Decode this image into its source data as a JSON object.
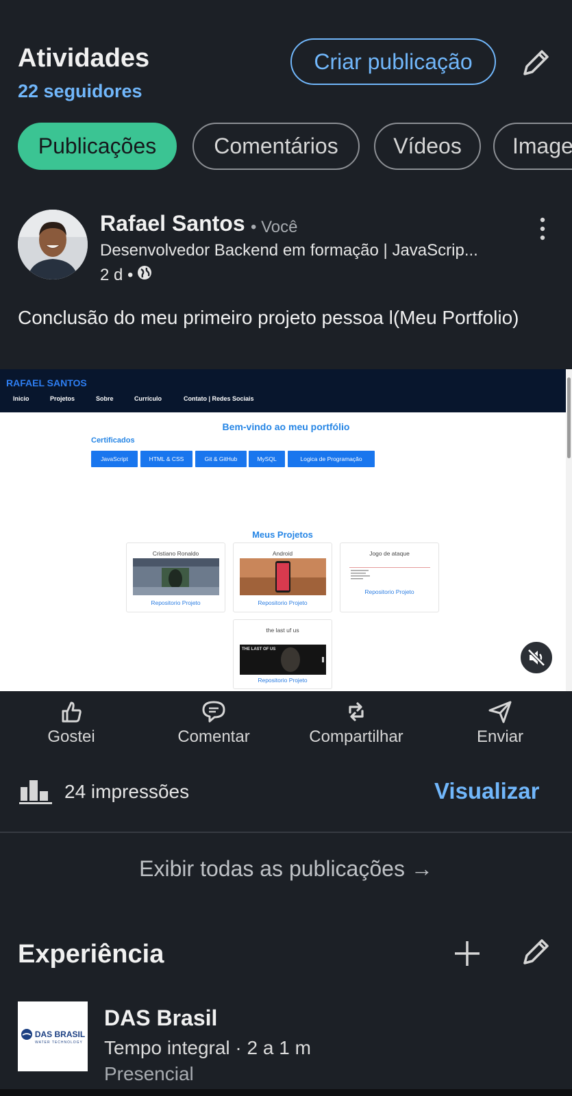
{
  "header": {
    "title": "Atividades",
    "followers": "22 seguidores",
    "create_post_label": "Criar publicação"
  },
  "tabs": [
    {
      "label": "Publicações",
      "active": true
    },
    {
      "label": "Comentários",
      "active": false
    },
    {
      "label": "Vídeos",
      "active": false
    },
    {
      "label": "Image",
      "active": false
    }
  ],
  "post": {
    "author": "Rafael Santos",
    "you_label": "• Você",
    "headline": "Desenvolvedor Backend em formação | JavaScrip...",
    "time": "2 d •",
    "text": "Conclusão do meu primeiro projeto pessoa l(Meu Portfolio)",
    "image": {
      "brand": "RAFAEL SANTOS",
      "nav": [
        "Inicio",
        "Projetos",
        "Sobre",
        "Currículo",
        "Contato | Redes Sociais"
      ],
      "welcome": "Bem-vindo ao meu portfólio",
      "certificates_title": "Certificados",
      "certificates": [
        "JavaScript",
        "HTML & CSS",
        "Git & GitHub",
        "MySQL",
        "Logica de Programação"
      ],
      "projects_title": "Meus Projetos",
      "projects": [
        {
          "title": "Cristiano Ronaldo",
          "link": "Repositorio Projeto"
        },
        {
          "title": "Android",
          "link": "Repositorio Projeto"
        },
        {
          "title": "Jogo de ataque",
          "link": "Repositorio Projeto"
        },
        {
          "title": "the last uf us",
          "link": "Repositorio Projeto"
        }
      ],
      "tlou_logo": "THE LAST OF US"
    },
    "actions": {
      "like": "Gostei",
      "comment": "Comentar",
      "share": "Compartilhar",
      "send": "Enviar"
    },
    "impressions": "24 impressões",
    "view_analytics": "Visualizar"
  },
  "show_all": "Exibir todas as publicações →",
  "experience": {
    "title": "Experiência",
    "company": "DAS Brasil",
    "logo_text": "DAS BRASIL",
    "logo_sub": "WATER TECHNOLOGY",
    "employment": "Tempo integral · 2 a 1 m",
    "mode": "Presencial"
  },
  "colors": {
    "background": "#1c2026",
    "accent_blue": "#71b7fb",
    "active_tab": "#3bc493"
  }
}
